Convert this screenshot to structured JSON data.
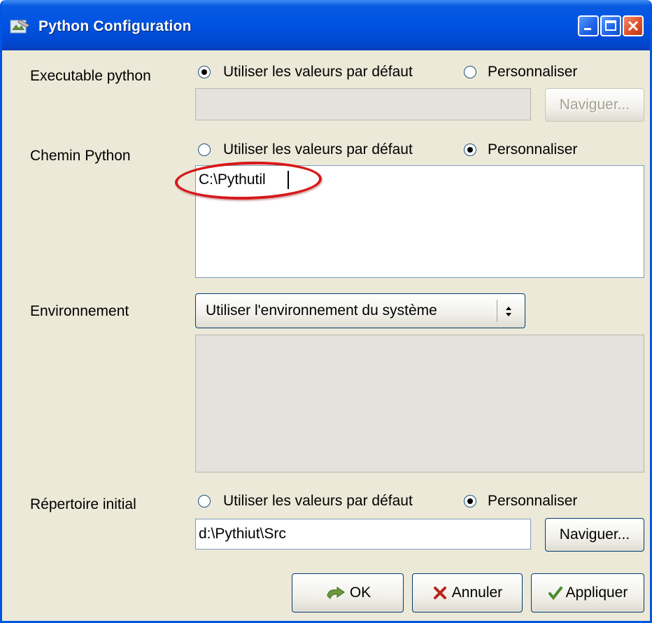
{
  "window": {
    "title": "Python Configuration"
  },
  "executable": {
    "label": "Executable python",
    "radio_default": "Utiliser les valeurs par défaut",
    "radio_custom": "Personnaliser",
    "selected": "default",
    "path_value": "",
    "browse_label": "Naviguer..."
  },
  "chemin": {
    "label": "Chemin Python",
    "radio_default": "Utiliser les valeurs par défaut",
    "radio_custom": "Personnaliser",
    "selected": "custom",
    "value": "C:\\Pythutil"
  },
  "environnement": {
    "label": "Environnement",
    "select_value": "Utiliser l'environnement du système",
    "text_value": ""
  },
  "repertoire": {
    "label": "Répertoire initial",
    "radio_default": "Utiliser les valeurs par défaut",
    "radio_custom": "Personnaliser",
    "selected": "custom",
    "value": "d:\\Pythiut\\Src",
    "browse_label": "Naviguer..."
  },
  "buttons": {
    "ok": "OK",
    "cancel": "Annuler",
    "apply": "Appliquer"
  },
  "colors": {
    "titlebar": "#0054e3",
    "window_bg": "#ece9d8",
    "highlight": "#d7181a"
  }
}
